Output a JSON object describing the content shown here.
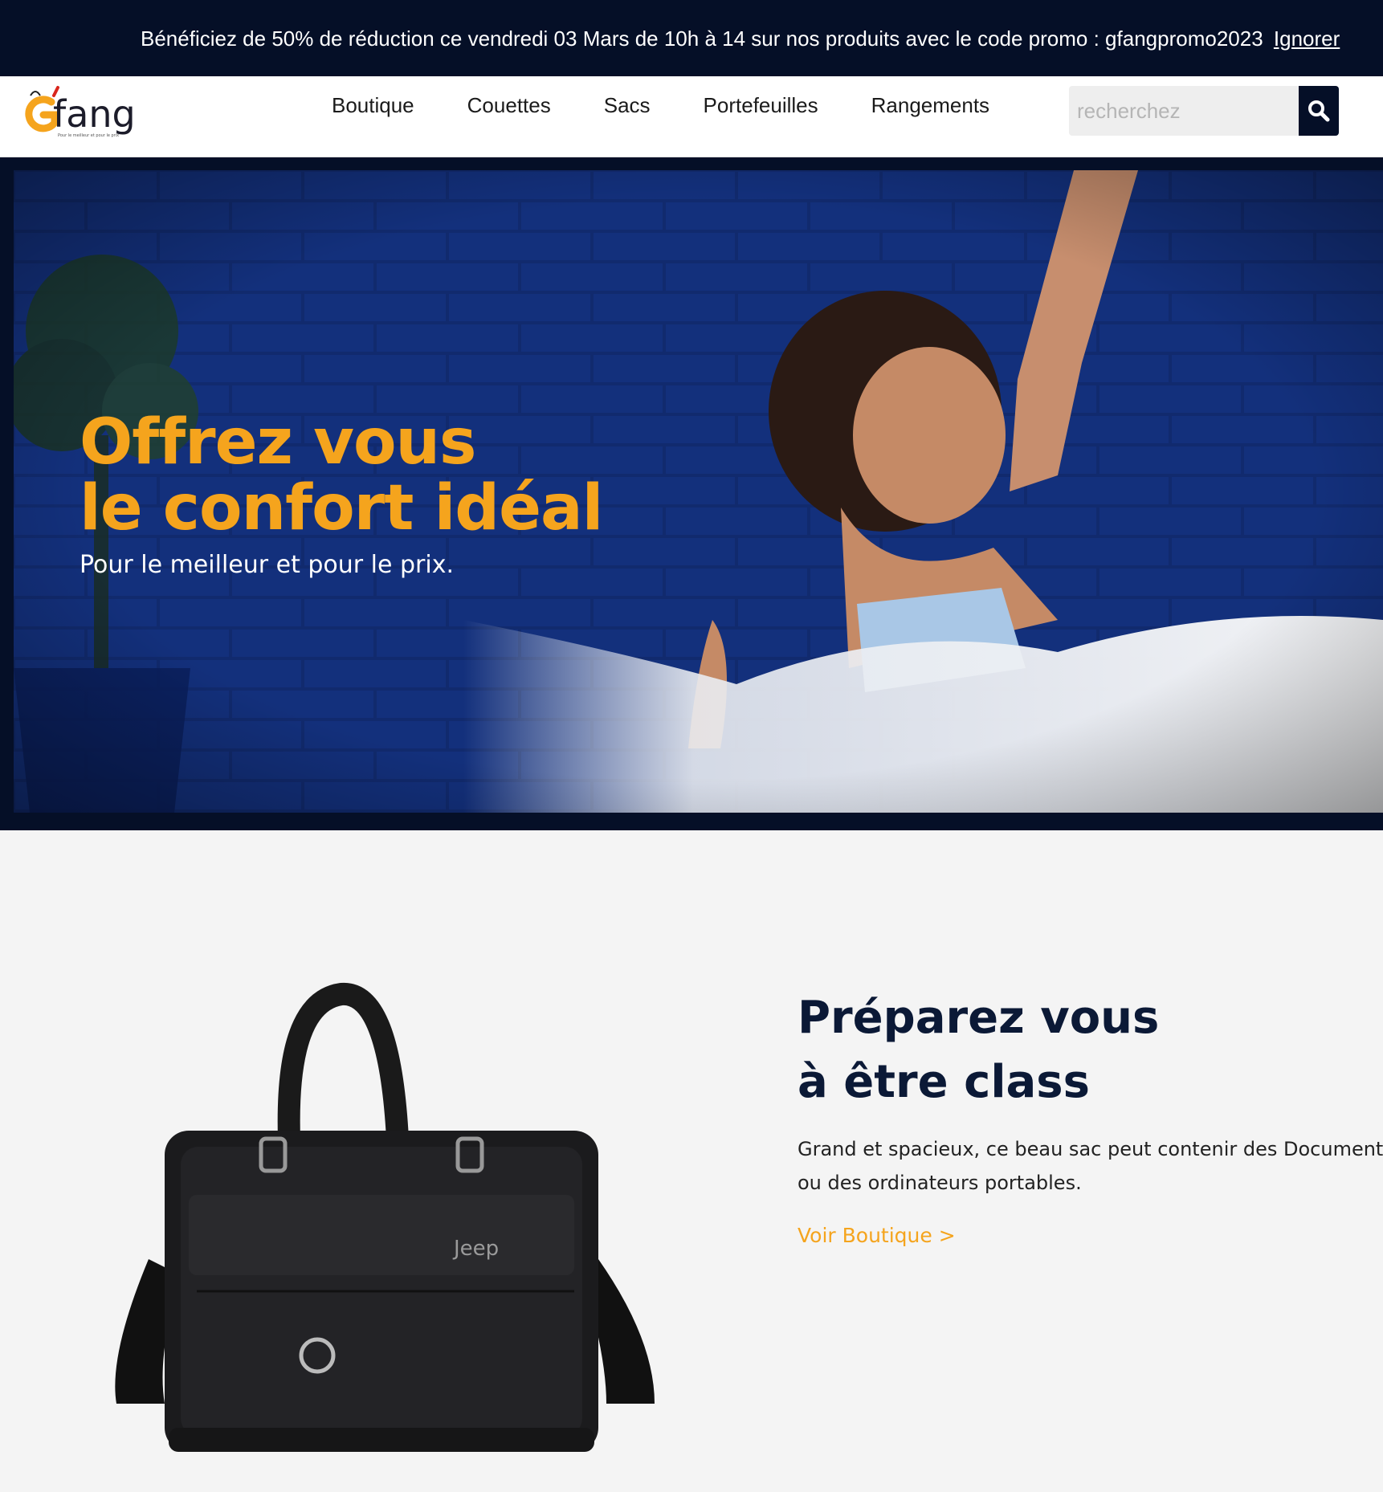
{
  "promo": {
    "text": "Bénéficiez de 50% de réduction ce vendredi 03 Mars de 10h à 14 sur nos produits avec le code promo : gfangpromo2023",
    "dismiss_label": "Ignorer"
  },
  "header": {
    "logo": {
      "text": "Gfang",
      "icon": "gfang-logo-icon"
    },
    "nav": [
      {
        "label": "Boutique"
      },
      {
        "label": "Couettes"
      },
      {
        "label": "Sacs"
      },
      {
        "label": "Portefeuilles"
      },
      {
        "label": "Rangements"
      }
    ],
    "search": {
      "placeholder": "recherchez",
      "value": "",
      "icon": "search-icon"
    }
  },
  "hero": {
    "title_line1": "Offrez vous",
    "title_line2": "le confort idéal",
    "subtitle": "Pour le meilleur et pour le prix."
  },
  "product": {
    "title_line1": "Préparez vous",
    "title_line2": "à être class",
    "desc_line1": "Grand et spacieux, ce beau sac peut contenir des Documents",
    "desc_line2": "ou des ordinateurs portables.",
    "link_label": "Voir Boutique >",
    "bag_brand": "Jeep"
  },
  "colors": {
    "navy": "#050f27",
    "accent": "#f5a41d",
    "hero_blue": "#0f2766",
    "section_bg": "#f4f4f4"
  }
}
